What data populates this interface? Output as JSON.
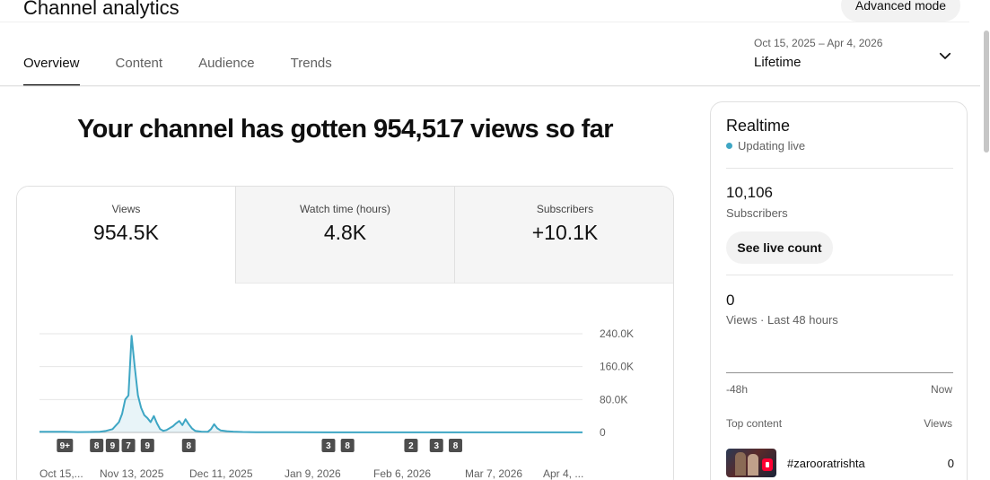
{
  "header": {
    "title": "Channel analytics",
    "advanced_label": "Advanced mode",
    "tabs": [
      {
        "label": "Overview",
        "active": true
      },
      {
        "label": "Content",
        "active": false
      },
      {
        "label": "Audience",
        "active": false
      },
      {
        "label": "Trends",
        "active": false
      }
    ],
    "date_range": {
      "dates": "Oct 15, 2025 – Apr 4, 2026",
      "period": "Lifetime",
      "icon": "chevron-down-icon"
    }
  },
  "overview": {
    "headline": "Your channel has gotten 954,517 views so far",
    "metrics": [
      {
        "label": "Views",
        "value": "954.5K"
      },
      {
        "label": "Watch time (hours)",
        "value": "4.8K"
      },
      {
        "label": "Subscribers",
        "value": "+10.1K"
      }
    ]
  },
  "chart_data": {
    "type": "area",
    "title": "",
    "xlabel": "",
    "ylabel": "",
    "ylim": [
      0,
      240000
    ],
    "y_ticks": [
      "0",
      "80.0K",
      "160.0K",
      "240.0K"
    ],
    "x_tick_labels": [
      "Oct 15,...",
      "Nov 13, 2025",
      "Dec 11, 2025",
      "Jan 9, 2026",
      "Feb 6, 2026",
      "Mar 7, 2026",
      "Apr 4, ..."
    ],
    "grid": true,
    "series_color": "#3ea6c4",
    "start_date": "2025-10-15",
    "end_date": "2026-04-04",
    "values": [
      [
        "2025-10-15",
        1500
      ],
      [
        "2025-10-19",
        1800
      ],
      [
        "2025-10-23",
        1500
      ],
      [
        "2025-10-27",
        800
      ],
      [
        "2025-10-31",
        1000
      ],
      [
        "2025-11-03",
        1500
      ],
      [
        "2025-11-05",
        4000
      ],
      [
        "2025-11-07",
        8000
      ],
      [
        "2025-11-09",
        25000
      ],
      [
        "2025-11-10",
        45000
      ],
      [
        "2025-11-11",
        80000
      ],
      [
        "2025-11-12",
        90000
      ],
      [
        "2025-11-13",
        235000
      ],
      [
        "2025-11-14",
        160000
      ],
      [
        "2025-11-15",
        90000
      ],
      [
        "2025-11-16",
        60000
      ],
      [
        "2025-11-17",
        42000
      ],
      [
        "2025-11-18",
        35000
      ],
      [
        "2025-11-19",
        25000
      ],
      [
        "2025-11-20",
        40000
      ],
      [
        "2025-11-21",
        22000
      ],
      [
        "2025-11-22",
        8000
      ],
      [
        "2025-11-23",
        4000
      ],
      [
        "2025-11-24",
        6000
      ],
      [
        "2025-11-26",
        15000
      ],
      [
        "2025-11-27",
        22000
      ],
      [
        "2025-11-28",
        28000
      ],
      [
        "2025-11-29",
        18000
      ],
      [
        "2025-11-30",
        32000
      ],
      [
        "2025-12-01",
        20000
      ],
      [
        "2025-12-02",
        10000
      ],
      [
        "2025-12-03",
        4000
      ],
      [
        "2025-12-05",
        2000
      ],
      [
        "2025-12-07",
        1500
      ],
      [
        "2025-12-08",
        8000
      ],
      [
        "2025-12-09",
        20000
      ],
      [
        "2025-12-10",
        10000
      ],
      [
        "2025-12-11",
        5000
      ],
      [
        "2025-12-13",
        3000
      ],
      [
        "2025-12-15",
        2000
      ],
      [
        "2025-12-18",
        1000
      ],
      [
        "2025-12-22",
        600
      ],
      [
        "2026-01-01",
        400
      ],
      [
        "2026-01-15",
        300
      ],
      [
        "2026-02-01",
        300
      ],
      [
        "2026-02-20",
        200
      ],
      [
        "2026-03-10",
        200
      ],
      [
        "2026-04-04",
        200
      ]
    ],
    "markers": [
      {
        "label": "9+",
        "date": "2025-10-23"
      },
      {
        "label": "8",
        "date": "2025-11-02"
      },
      {
        "label": "9",
        "date": "2025-11-07"
      },
      {
        "label": "7",
        "date": "2025-11-12"
      },
      {
        "label": "9",
        "date": "2025-11-18"
      },
      {
        "label": "8",
        "date": "2025-12-01"
      },
      {
        "label": "3",
        "date": "2026-01-14"
      },
      {
        "label": "8",
        "date": "2026-01-20"
      },
      {
        "label": "2",
        "date": "2026-02-09"
      },
      {
        "label": "3",
        "date": "2026-02-17"
      },
      {
        "label": "8",
        "date": "2026-02-23"
      }
    ]
  },
  "realtime": {
    "title": "Realtime",
    "status": "Updating live",
    "subscribers": "10,106",
    "subscribers_label": "Subscribers",
    "live_count_label": "See live count",
    "views": "0",
    "views_label": "Views · Last 48 hours",
    "axis_start": "-48h",
    "axis_end": "Now",
    "top_content_label": "Top content",
    "top_views_label": "Views",
    "top_items": [
      {
        "title": "#zarooratrishta",
        "views": "0"
      }
    ]
  }
}
